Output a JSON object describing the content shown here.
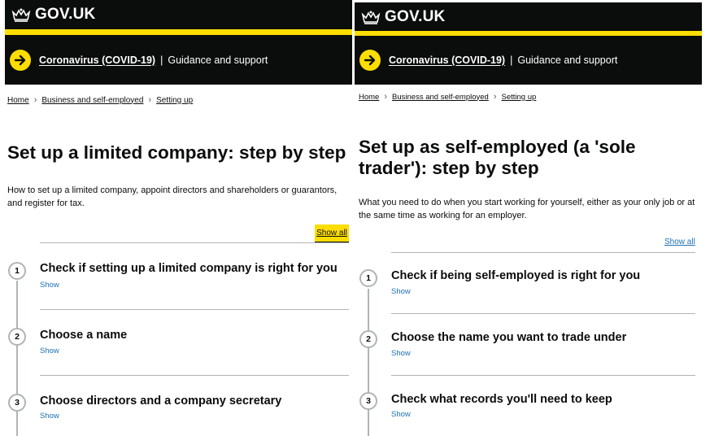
{
  "left": {
    "header": {
      "logo_text": "GOV.UK",
      "logo_icon": "crown-icon"
    },
    "banner": {
      "link": "Coronavirus (COVID-19)",
      "separator": "|",
      "text": "Guidance and support",
      "icon": "arrow-right-icon"
    },
    "breadcrumb": [
      "Home",
      "Business and self-employed",
      "Setting up"
    ],
    "title": "Set up a limited company: step by step",
    "lede": "How to set up a limited company, appoint directors and shareholders or guarantors, and register for tax.",
    "show_all": "Show all",
    "steps": [
      {
        "number": "1",
        "title": "Check if setting up a limited company is right for you",
        "show": "Show"
      },
      {
        "number": "2",
        "title": "Choose a name",
        "show": "Show"
      },
      {
        "number": "3",
        "title": "Choose directors and a company secretary",
        "show": "Show"
      }
    ]
  },
  "right": {
    "header": {
      "logo_text": "GOV.UK",
      "logo_icon": "crown-icon"
    },
    "banner": {
      "link": "Coronavirus (COVID-19)",
      "separator": "|",
      "text": "Guidance and support",
      "icon": "arrow-right-icon"
    },
    "breadcrumb": [
      "Home",
      "Business and self-employed",
      "Setting up"
    ],
    "title": "Set up as self-employed (a 'sole trader'): step by step",
    "lede": "What you need to do when you start working for yourself, either as your only job or at the same time as working for an employer.",
    "show_all": "Show all",
    "steps": [
      {
        "number": "1",
        "title": "Check if being self-employed is right for you",
        "show": "Show"
      },
      {
        "number": "2",
        "title": "Choose the name you want to trade under",
        "show": "Show"
      },
      {
        "number": "3",
        "title": "Check what records you'll need to keep",
        "show": "Show"
      }
    ]
  },
  "colors": {
    "header_bg": "#0b0c0c",
    "accent_yellow": "#ffdd00",
    "link_blue": "#1d70b8",
    "rule_grey": "#b1b4b6"
  }
}
